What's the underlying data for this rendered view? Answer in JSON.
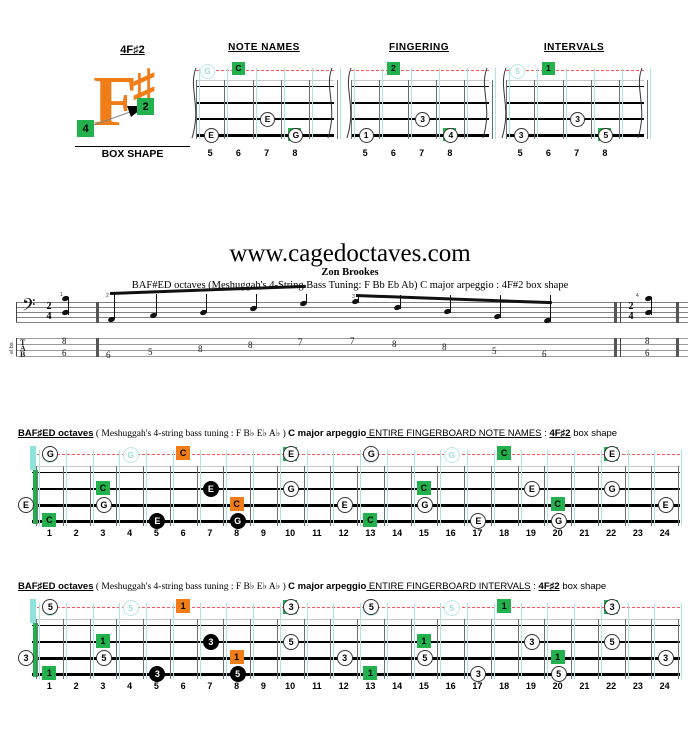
{
  "logo": {
    "title_pre": "4F",
    "title_sharp": "♯",
    "title_post": "2",
    "letter": "F",
    "sharp_symbol": "♯",
    "square_top_label": "2",
    "square_bottom_label": "4",
    "caption": "BOX SHAPE",
    "colors": {
      "orange": "#F07D18",
      "green": "#22B14C"
    }
  },
  "mini_diagrams": [
    {
      "title": "NOTE NAMES",
      "fret_numbers": [
        "5",
        "6",
        "7",
        "8"
      ],
      "ghost_note": "G",
      "markers": [
        {
          "fret": 7,
          "string": 2,
          "label": "E",
          "style": "circle"
        },
        {
          "fret": 8,
          "string": 3,
          "label": "C",
          "style": "square-green"
        },
        {
          "fret": 5,
          "string": 3,
          "label": "E",
          "style": "circle"
        },
        {
          "fret": 8,
          "string": 3,
          "label": "G",
          "style": "circle"
        },
        {
          "fret": 6,
          "string": 4,
          "label": "C",
          "style": "square-green"
        }
      ]
    },
    {
      "title": "FINGERING",
      "fret_numbers": [
        "5",
        "6",
        "7",
        "8"
      ],
      "ghost_note": "",
      "markers": [
        {
          "fret": 7,
          "string": 2,
          "label": "3",
          "style": "circle"
        },
        {
          "fret": 8,
          "string": 3,
          "label": "4",
          "style": "square-green"
        },
        {
          "fret": 5,
          "string": 3,
          "label": "1",
          "style": "circle"
        },
        {
          "fret": 8,
          "string": 3,
          "label": "4",
          "style": "circle"
        },
        {
          "fret": 6,
          "string": 4,
          "label": "2",
          "style": "square-green"
        }
      ]
    },
    {
      "title": "INTERVALS",
      "fret_numbers": [
        "5",
        "6",
        "7",
        "8"
      ],
      "ghost_note": "5",
      "markers": [
        {
          "fret": 7,
          "string": 2,
          "label": "3",
          "style": "circle"
        },
        {
          "fret": 8,
          "string": 3,
          "label": "1",
          "style": "square-green"
        },
        {
          "fret": 5,
          "string": 3,
          "label": "3",
          "style": "circle"
        },
        {
          "fret": 8,
          "string": 3,
          "label": "5",
          "style": "circle"
        },
        {
          "fret": 6,
          "string": 4,
          "label": "1",
          "style": "square-green"
        }
      ]
    }
  ],
  "center": {
    "url": "www.cagedoctaves.com",
    "author": "Zon Brookes",
    "subtitle": "BAF#ED octaves (Meshuggah's 4-String Bass Tuning: F Bb Eb Ab) C major arpeggio : 4F#2 box shape"
  },
  "staff": {
    "clef": "𝄢",
    "time_sig_top": "2",
    "time_sig_bottom": "4",
    "tab_clef_t": "T",
    "tab_clef_a": "A",
    "tab_clef_b": "B",
    "instrument_label": "el.bs.",
    "pickup_tab": [
      "8",
      "6"
    ],
    "measure1_tab": [
      "6",
      "5",
      "8",
      "8",
      "7"
    ],
    "measure2_tab": [
      "7",
      "8",
      "8",
      "5",
      "6"
    ],
    "final_tab": [
      "8",
      "6"
    ],
    "measure_numbers": [
      "1",
      "2",
      "3",
      "4"
    ]
  },
  "sections": [
    {
      "id": "note-names",
      "head_bold1": "BAF",
      "head_sharp1": "♯",
      "head_bold2": "ED octaves",
      "head_plain1": " ( Meshuggah's 4-string bass tuning : F B",
      "head_flat1": "♭",
      "head_plain2": " E",
      "head_flat2": "♭",
      "head_plain3": " A",
      "head_flat3": "♭",
      "head_plain4": " ) ",
      "head_bold3": "C major arpeggio",
      "head_underline": " ENTIRE FINGERBOARD NOTE NAMES",
      "head_plain5": " : ",
      "head_bold4": "4F",
      "head_sharp2": "♯",
      "head_bold5": "2",
      "head_plain6": " box shape",
      "fret_numbers": [
        "1",
        "2",
        "3",
        "4",
        "5",
        "6",
        "7",
        "8",
        "9",
        "10",
        "11",
        "12",
        "13",
        "14",
        "15",
        "16",
        "17",
        "18",
        "19",
        "20",
        "21",
        "22",
        "23",
        "24"
      ],
      "open_markers": [
        {
          "string": 2,
          "label": "E"
        }
      ],
      "ghost_markers": [
        {
          "fret": 1,
          "label": "E"
        },
        {
          "fret": 4,
          "label": "G"
        },
        {
          "fret": 13,
          "label": "E"
        },
        {
          "fret": 16,
          "label": "G"
        }
      ],
      "markers": [
        {
          "fret": 3,
          "string": 1,
          "label": "C",
          "style": "square-green"
        },
        {
          "fret": 7,
          "string": 1,
          "label": "E",
          "style": "circle-black"
        },
        {
          "fret": 10,
          "string": 0,
          "label": "C",
          "style": "square-green"
        },
        {
          "fret": 10,
          "string": 1,
          "label": "G",
          "style": "circle"
        },
        {
          "fret": 3,
          "string": 2,
          "label": "G",
          "style": "circle"
        },
        {
          "fret": 8,
          "string": 2,
          "label": "C",
          "style": "square-orange"
        },
        {
          "fret": 12,
          "string": 2,
          "label": "E",
          "style": "circle"
        },
        {
          "fret": 1,
          "string": 3,
          "label": "C",
          "style": "square-green"
        },
        {
          "fret": 5,
          "string": 3,
          "label": "E",
          "style": "circle-black"
        },
        {
          "fret": 8,
          "string": 3,
          "label": "G",
          "style": "circle-black"
        },
        {
          "fret": 1,
          "string": 4,
          "label": "G",
          "style": "circle"
        },
        {
          "fret": 6,
          "string": 4,
          "label": "C",
          "style": "square-orange"
        },
        {
          "fret": 10,
          "string": 4,
          "label": "E",
          "style": "circle"
        },
        {
          "fret": 15,
          "string": 1,
          "label": "C",
          "style": "square-green"
        },
        {
          "fret": 19,
          "string": 1,
          "label": "E",
          "style": "circle"
        },
        {
          "fret": 22,
          "string": 0,
          "label": "C",
          "style": "square-green"
        },
        {
          "fret": 22,
          "string": 1,
          "label": "G",
          "style": "circle"
        },
        {
          "fret": 15,
          "string": 2,
          "label": "G",
          "style": "circle"
        },
        {
          "fret": 20,
          "string": 2,
          "label": "C",
          "style": "square-green"
        },
        {
          "fret": 24,
          "string": 2,
          "label": "E",
          "style": "circle"
        },
        {
          "fret": 13,
          "string": 3,
          "label": "C",
          "style": "square-green"
        },
        {
          "fret": 17,
          "string": 3,
          "label": "E",
          "style": "circle"
        },
        {
          "fret": 20,
          "string": 3,
          "label": "G",
          "style": "circle"
        },
        {
          "fret": 13,
          "string": 4,
          "label": "G",
          "style": "circle"
        },
        {
          "fret": 18,
          "string": 4,
          "label": "C",
          "style": "square-green"
        },
        {
          "fret": 22,
          "string": 4,
          "label": "E",
          "style": "circle"
        }
      ]
    },
    {
      "id": "intervals",
      "head_bold1": "BAF",
      "head_sharp1": "♯",
      "head_bold2": "ED octaves",
      "head_plain1": " ( Meshuggah's 4-string bass tuning : F B",
      "head_flat1": "♭",
      "head_plain2": " E",
      "head_flat2": "♭",
      "head_plain3": " A",
      "head_flat3": "♭",
      "head_plain4": " ) ",
      "head_bold3": "C major arpeggio",
      "head_underline": " ENTIRE FINGERBOARD INTERVALS",
      "head_plain5": " : ",
      "head_bold4": "4F",
      "head_sharp2": "♯",
      "head_bold5": "2",
      "head_plain6": " box shape",
      "fret_numbers": [
        "1",
        "2",
        "3",
        "4",
        "5",
        "6",
        "7",
        "8",
        "9",
        "10",
        "11",
        "12",
        "13",
        "14",
        "15",
        "16",
        "17",
        "18",
        "19",
        "20",
        "21",
        "22",
        "23",
        "24"
      ],
      "open_markers": [
        {
          "string": 2,
          "label": "3"
        }
      ],
      "ghost_markers": [
        {
          "fret": 1,
          "label": "3"
        },
        {
          "fret": 4,
          "label": "5"
        },
        {
          "fret": 13,
          "label": "3"
        },
        {
          "fret": 16,
          "label": "5"
        }
      ],
      "markers": [
        {
          "fret": 3,
          "string": 1,
          "label": "1",
          "style": "square-green"
        },
        {
          "fret": 7,
          "string": 1,
          "label": "3",
          "style": "circle-black"
        },
        {
          "fret": 10,
          "string": 0,
          "label": "1",
          "style": "square-green"
        },
        {
          "fret": 10,
          "string": 1,
          "label": "5",
          "style": "circle"
        },
        {
          "fret": 3,
          "string": 2,
          "label": "5",
          "style": "circle"
        },
        {
          "fret": 8,
          "string": 2,
          "label": "1",
          "style": "square-orange"
        },
        {
          "fret": 12,
          "string": 2,
          "label": "3",
          "style": "circle"
        },
        {
          "fret": 1,
          "string": 3,
          "label": "1",
          "style": "square-green"
        },
        {
          "fret": 5,
          "string": 3,
          "label": "3",
          "style": "circle-black"
        },
        {
          "fret": 8,
          "string": 3,
          "label": "5",
          "style": "circle-black"
        },
        {
          "fret": 1,
          "string": 4,
          "label": "5",
          "style": "circle"
        },
        {
          "fret": 6,
          "string": 4,
          "label": "1",
          "style": "square-orange"
        },
        {
          "fret": 10,
          "string": 4,
          "label": "3",
          "style": "circle"
        },
        {
          "fret": 15,
          "string": 1,
          "label": "1",
          "style": "square-green"
        },
        {
          "fret": 19,
          "string": 1,
          "label": "3",
          "style": "circle"
        },
        {
          "fret": 22,
          "string": 0,
          "label": "1",
          "style": "square-green"
        },
        {
          "fret": 22,
          "string": 1,
          "label": "5",
          "style": "circle"
        },
        {
          "fret": 15,
          "string": 2,
          "label": "5",
          "style": "circle"
        },
        {
          "fret": 20,
          "string": 2,
          "label": "1",
          "style": "square-green"
        },
        {
          "fret": 24,
          "string": 2,
          "label": "3",
          "style": "circle"
        },
        {
          "fret": 13,
          "string": 3,
          "label": "1",
          "style": "square-green"
        },
        {
          "fret": 17,
          "string": 3,
          "label": "3",
          "style": "circle"
        },
        {
          "fret": 20,
          "string": 3,
          "label": "5",
          "style": "circle"
        },
        {
          "fret": 13,
          "string": 4,
          "label": "5",
          "style": "circle"
        },
        {
          "fret": 18,
          "string": 4,
          "label": "1",
          "style": "square-green"
        },
        {
          "fret": 22,
          "string": 4,
          "label": "3",
          "style": "circle"
        }
      ]
    }
  ]
}
